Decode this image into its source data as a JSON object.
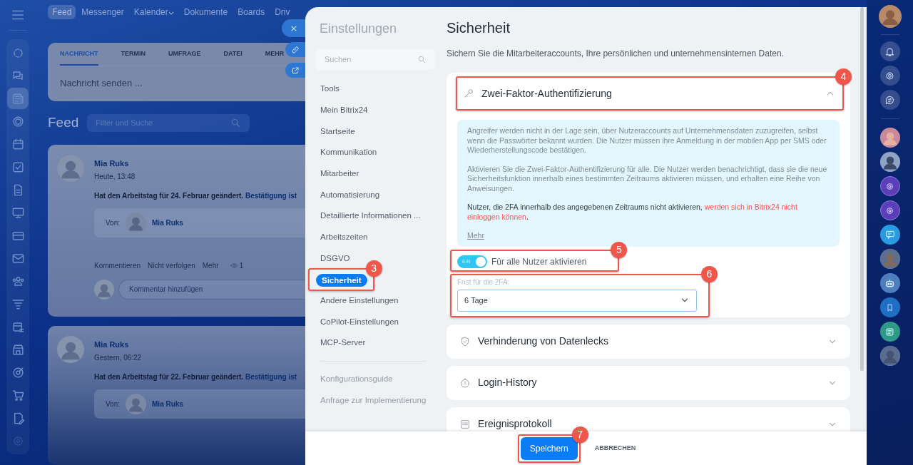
{
  "top_nav": [
    {
      "label": "Feed",
      "selected": true,
      "has_menu": false
    },
    {
      "label": "Messenger",
      "selected": false,
      "has_menu": false
    },
    {
      "label": "Kalender",
      "selected": false,
      "has_menu": true
    },
    {
      "label": "Dokumente",
      "selected": false,
      "has_menu": false
    },
    {
      "label": "Boards",
      "selected": false,
      "has_menu": false
    },
    {
      "label": "Driv",
      "selected": false,
      "has_menu": false
    }
  ],
  "nav_rail": {
    "items": [
      {
        "selected": false
      },
      {
        "selected": false
      },
      {
        "selected": true
      },
      {
        "selected": false
      },
      {
        "selected": false
      },
      {
        "selected": false
      },
      {
        "selected": false
      },
      {
        "selected": false
      },
      {
        "selected": false
      },
      {
        "selected": false
      },
      {
        "selected": false
      },
      {
        "selected": false
      },
      {
        "selected": false
      },
      {
        "selected": false
      },
      {
        "selected": false
      },
      {
        "selected": false
      },
      {
        "selected": false
      },
      {
        "selected": false
      }
    ]
  },
  "composer": {
    "tabs": [
      {
        "label": "NACHRICHT",
        "selected": true
      },
      {
        "label": "TERMIN",
        "selected": false
      },
      {
        "label": "UMFRAGE",
        "selected": false
      },
      {
        "label": "DATEI",
        "selected": false
      },
      {
        "label": "MEHR",
        "selected": false
      }
    ],
    "placeholder": "Nachricht senden ..."
  },
  "feed": {
    "title": "Feed",
    "filter_placeholder": "Filter und Suche",
    "posts": [
      {
        "author": "Mia Ruks",
        "time": "Heute, 13:48",
        "text": "Hat den Arbeitstag für 24. Februar geändert.",
        "link": "Bestätigung ist",
        "from_label": "Von:",
        "from_name": "Mia Ruks",
        "actions": [
          "Kommentieren",
          "Nicht verfolgen",
          "Mehr"
        ],
        "views": "1",
        "comment_placeholder": "Kommentar hinzufügen"
      },
      {
        "author": "Mia Ruks",
        "time": "Gestern, 06:22",
        "text": "Hat den Arbeitstag für 22. Februar geändert.",
        "link": "Bestätigung ist",
        "from_label": "Von:",
        "from_name": "Mia Ruks"
      }
    ]
  },
  "settings": {
    "title": "Einstellungen",
    "search_placeholder": "Suchen",
    "items": [
      {
        "label": "Tools",
        "selected": false
      },
      {
        "label": "Mein Bitrix24",
        "selected": false
      },
      {
        "label": "Startseite",
        "selected": false
      },
      {
        "label": "Kommunikation",
        "selected": false
      },
      {
        "label": "Mitarbeiter",
        "selected": false
      },
      {
        "label": "Automatisierung",
        "selected": false
      },
      {
        "label": "Detaillierte Informationen ...",
        "selected": false
      },
      {
        "label": "Arbeitszeiten",
        "selected": false
      },
      {
        "label": "DSGVO",
        "selected": false
      },
      {
        "label": "Sicherheit",
        "selected": true,
        "callout": "3"
      },
      {
        "label": "Andere Einstellungen",
        "selected": false
      },
      {
        "label": "CoPilot-Einstellungen",
        "selected": false
      },
      {
        "label": "MCP-Server",
        "selected": false
      }
    ],
    "links": [
      "Konfigurationsguide",
      "Anfrage zur Implementierung"
    ]
  },
  "page": {
    "title": "Sicherheit",
    "subtitle": "Sichern Sie die Mitarbeiteraccounts, Ihre persönlichen und unternehmensinternen Daten.",
    "sections": [
      {
        "title": "Zwei-Faktor-Authentifizierung",
        "expanded": true,
        "callout": "4",
        "info": [
          "Angreifer werden nicht in der Lage sein, über Nutzeraccounts auf Unternehmensdaten zuzugreifen, selbst wenn die Passwörter bekannt wurden. Die Nutzer müssen ihre Anmeldung in der mobilen App per SMS oder Wiederherstellungscode bestätigen.",
          "Aktivieren Sie die Zwei-Faktor-Authentifizierung für alle. Die Nutzer werden benachrichtigt, dass sie die neue Sicherheitsfunktion innerhalb eines bestimmten Zeitraums aktivieren müssen, und erhalten eine Reihe von Anweisungen."
        ],
        "warning": {
          "text": "Nutzer, die 2FA innerhalb des angegebenen Zeitraums nicht aktivieren,",
          "highlight": "werden sich in Bitrix24 nicht einloggen können",
          "end": "."
        },
        "more_link": "Mehr",
        "toggle": {
          "label": "Für alle Nutzer aktivieren",
          "on": true,
          "state_text": "EIN",
          "callout": "5"
        },
        "deadline": {
          "label": "Frist für die 2FA:",
          "value": "6 Tage",
          "callout": "6"
        }
      },
      {
        "title": "Verhinderung von Datenlecks",
        "expanded": false
      },
      {
        "title": "Login-History",
        "expanded": false
      },
      {
        "title": "Ereignisprotokoll",
        "expanded": false
      }
    ]
  },
  "footer": {
    "save": {
      "label": "Speichern",
      "callout": "7"
    },
    "cancel": "ABBRECHEN"
  }
}
